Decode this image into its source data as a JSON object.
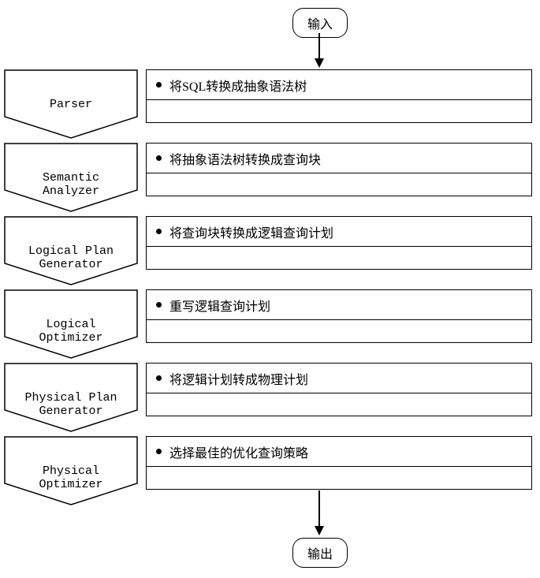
{
  "input_label": "输入",
  "output_label": "输出",
  "stages": [
    {
      "name": "Parser",
      "desc": "将SQL转换成抽象语法树"
    },
    {
      "name": "Semantic\nAnalyzer",
      "desc": "将抽象语法树转换成查询块"
    },
    {
      "name": "Logical Plan\nGenerator",
      "desc": "将查询块转换成逻辑查询计划"
    },
    {
      "name": "Logical\nOptimizer",
      "desc": "重写逻辑查询计划"
    },
    {
      "name": "Physical Plan\nGenerator",
      "desc": "将逻辑计划转成物理计划"
    },
    {
      "name": "Physical\nOptimizer",
      "desc": "选择最佳的优化查询策略"
    }
  ]
}
